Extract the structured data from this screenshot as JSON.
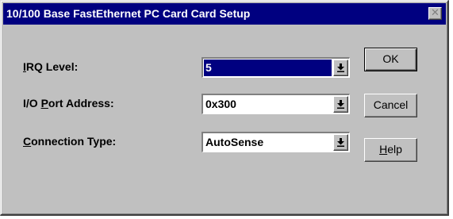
{
  "window": {
    "title": "10/100 Base FastEthernet PC Card Card Setup",
    "close_glyph": "✕"
  },
  "fields": {
    "irq": {
      "label_mnemonic": "I",
      "label_rest": "RQ Level:",
      "value": "5"
    },
    "io_port": {
      "label_pre": "I/O ",
      "label_mnemonic": "P",
      "label_rest": "ort Address:",
      "value": "0x300"
    },
    "connection": {
      "label_mnemonic": "C",
      "label_rest": "onnection Type:",
      "value": "AutoSense"
    }
  },
  "buttons": {
    "ok": "OK",
    "cancel": "Cancel",
    "help_mnemonic": "H",
    "help_rest": "elp"
  },
  "colors": {
    "title_bar": "#000080",
    "face": "#c0c0c0",
    "selection": "#000080"
  }
}
